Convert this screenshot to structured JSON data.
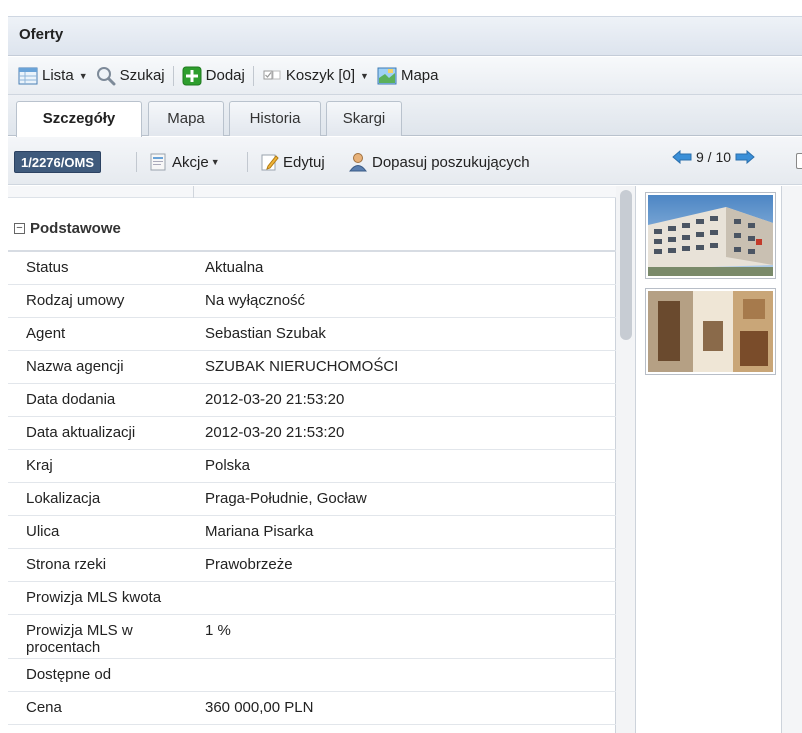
{
  "window": {
    "title": "Oferty"
  },
  "toolbar": {
    "lista": "Lista",
    "szukaj": "Szukaj",
    "dodaj": "Dodaj",
    "koszyk": "Koszyk [0]",
    "mapa": "Mapa"
  },
  "tabs": [
    {
      "label": "Szczegóły",
      "active": true
    },
    {
      "label": "Mapa"
    },
    {
      "label": "Historia"
    },
    {
      "label": "Skargi"
    }
  ],
  "actionbar": {
    "id_badge": "1/2276/OMS",
    "akcje": "Akcje",
    "edytuj": "Edytuj",
    "dopasuj": "Dopasuj poszukujących",
    "pagination": "9 / 10"
  },
  "section": {
    "title": "Podstawowe"
  },
  "details": [
    {
      "key": "Status",
      "value": "Aktualna"
    },
    {
      "key": "Rodzaj umowy",
      "value": "Na wyłączność"
    },
    {
      "key": "Agent",
      "value": "Sebastian Szubak"
    },
    {
      "key": "Nazwa agencji",
      "value": "SZUBAK NIERUCHOMOŚCI"
    },
    {
      "key": "Data dodania",
      "value": "2012-03-20 21:53:20"
    },
    {
      "key": "Data aktualizacji",
      "value": "2012-03-20 21:53:20"
    },
    {
      "key": "Kraj",
      "value": "Polska"
    },
    {
      "key": "Lokalizacja",
      "value": "Praga-Południe, Gocław"
    },
    {
      "key": "Ulica",
      "value": "Mariana Pisarka"
    },
    {
      "key": "Strona rzeki",
      "value": "Prawobrzeże"
    },
    {
      "key": "Prowizja MLS kwota",
      "value": ""
    },
    {
      "key": "Prowizja MLS w procentach",
      "value": "1 %"
    },
    {
      "key": "Dostępne od",
      "value": ""
    },
    {
      "key": "Cena",
      "value": "360 000,00 PLN"
    }
  ],
  "colors": {
    "accent": "#3f5a7c",
    "add_green": "#2e9e2e",
    "arrow_blue": "#3a8fd8"
  }
}
